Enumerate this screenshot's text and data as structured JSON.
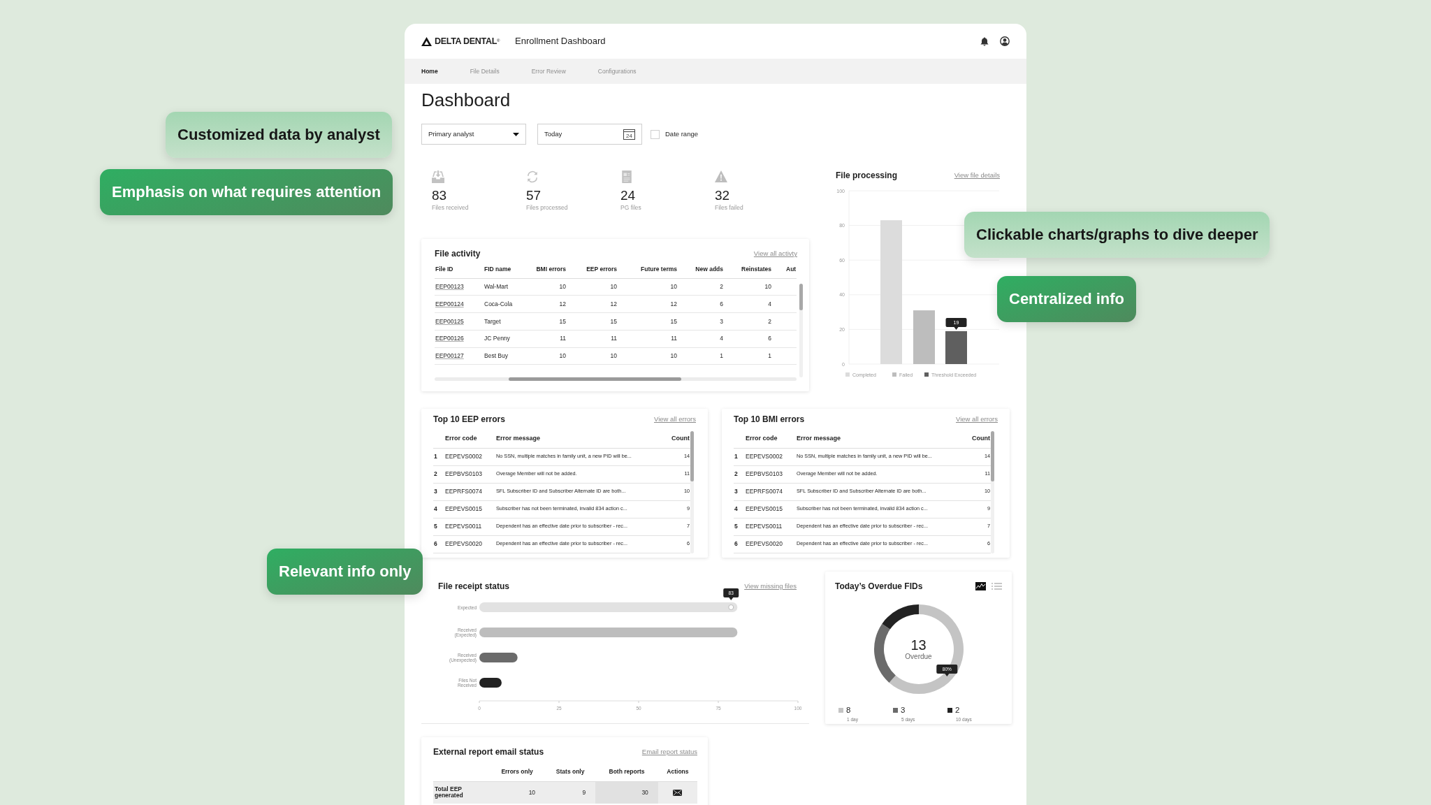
{
  "header": {
    "brand": "DELTA DENTAL$^{®}$",
    "app_title": "Enrollment Dashboard"
  },
  "nav": [
    {
      "label": "Home",
      "selected": true
    },
    {
      "label": "File Details",
      "selected": false
    },
    {
      "label": "Error Review",
      "selected": false
    },
    {
      "label": "Configurations",
      "selected": false
    }
  ],
  "page_title": "Dashboard",
  "filters": {
    "analyst_select": {
      "value": "Primary analyst"
    },
    "date_field": {
      "value": "Today",
      "calendar_day": "24"
    },
    "date_range": {
      "label": "Date range",
      "checked": false
    }
  },
  "stats": [
    {
      "kind": "received",
      "value": "83",
      "label": "Files received"
    },
    {
      "kind": "processed",
      "value": "57",
      "label": "Files processed"
    },
    {
      "kind": "pg",
      "value": "24",
      "label": "PG files"
    },
    {
      "kind": "failed",
      "value": "32",
      "label": "Files failed"
    }
  ],
  "file_processing": {
    "title": "File processing",
    "link": "View file details",
    "chart_data": {
      "type": "bar",
      "ylim": [
        0,
        100
      ],
      "yticks": [
        0,
        20,
        40,
        60,
        80,
        100
      ],
      "series": [
        {
          "name": "Completed",
          "color": "#dcdcdc",
          "values": [
            83
          ]
        },
        {
          "name": "Failed",
          "color": "#bdbdbd",
          "values": [
            31
          ]
        },
        {
          "name": "Threshold Exceeded",
          "color": "#5f5f5f",
          "values": [
            19
          ]
        }
      ],
      "grid": true,
      "legend": true,
      "annotations": [
        {
          "y": 19,
          "text": "19"
        }
      ]
    }
  },
  "file_activity": {
    "title": "File activity",
    "link": "View all activty",
    "columns": [
      "File ID",
      "FID name",
      "BMI errors",
      "EEP errors",
      "Future terms",
      "New adds",
      "Reinstates",
      "Aut"
    ],
    "rows": [
      {
        "cells": [
          "EEP00123",
          "Wal-Mart",
          "10",
          "10",
          "10",
          "2",
          "10"
        ]
      },
      {
        "cells": [
          "EEP00124",
          "Coca-Cola",
          "12",
          "12",
          "12",
          "6",
          "4"
        ]
      },
      {
        "cells": [
          "EEP00125",
          "Target",
          "15",
          "15",
          "15",
          "3",
          "2"
        ]
      },
      {
        "cells": [
          "EEP00126",
          "JC Penny",
          "11",
          "11",
          "11",
          "4",
          "6"
        ]
      },
      {
        "cells": [
          "EEP00127",
          "Best Buy",
          "10",
          "10",
          "10",
          "1",
          "1"
        ]
      }
    ]
  },
  "eep_errors": {
    "title": "Top 10 EEP errors",
    "link": "View all errors",
    "columns": [
      "Error code",
      "Error message",
      "Count"
    ],
    "rows": [
      {
        "rank": "1",
        "code": "EEPEVS0002",
        "message": "No SSN, multiple matches in family unit, a new PID will be...",
        "count": "14"
      },
      {
        "rank": "2",
        "code": "EEPBVS0103",
        "message": "Overage Member will not be added.",
        "count": "11"
      },
      {
        "rank": "3",
        "code": "EEPRFS0074",
        "message": "SFL Subscriber ID and Subscriber Alternate ID are both...",
        "count": "10"
      },
      {
        "rank": "4",
        "code": "EEPEVS0015",
        "message": "Subscriber has not been terminated, invalid 834 action c...",
        "count": "9"
      },
      {
        "rank": "5",
        "code": "EEPEVS0011",
        "message": "Dependent has an effective date prior to subscriber - rec...",
        "count": "7"
      },
      {
        "rank": "6",
        "code": "EEPEVS0020",
        "message": "Dependent has an effective date prior to subscriber - rec...",
        "count": "6"
      }
    ]
  },
  "bmi_errors": {
    "title": "Top 10 BMI errors",
    "link": "View all errors",
    "columns": [
      "Error code",
      "Error message",
      "Count"
    ],
    "rows": [
      {
        "rank": "1",
        "code": "EEPEVS0002",
        "message": "No SSN, multiple matches in family unit, a new PID will be...",
        "count": "14"
      },
      {
        "rank": "2",
        "code": "EEPBVS0103",
        "message": "Overage Member will not be added.",
        "count": "11"
      },
      {
        "rank": "3",
        "code": "EEPRFS0074",
        "message": "SFL Subscriber ID and Subscriber Alternate ID are both...",
        "count": "10"
      },
      {
        "rank": "4",
        "code": "EEPEVS0015",
        "message": "Subscriber has not been terminated, invalid 834 action c...",
        "count": "9"
      },
      {
        "rank": "5",
        "code": "EEPEVS0011",
        "message": "Dependent has an effective date prior to subscriber - rec...",
        "count": "7"
      },
      {
        "rank": "6",
        "code": "EEPEVS0020",
        "message": "Dependent has an effective date prior to subscriber - rec...",
        "count": "6"
      }
    ]
  },
  "file_receipt": {
    "title": "File receipt status",
    "link": "View missing files",
    "chart_data": {
      "type": "bar",
      "orientation": "horizontal",
      "stacked": true,
      "categories": [
        "Expected",
        "Received (Expected)",
        "Received (Unexpected)",
        "Files Not Received"
      ],
      "xlim": [
        0,
        100
      ],
      "xticks": [
        0,
        25,
        50,
        75,
        100
      ],
      "series": [
        {
          "color": "#e2e2e2",
          "values": [
            81,
            null,
            null,
            null
          ]
        },
        {
          "color": "#bdbdbd",
          "values": [
            null,
            81,
            null,
            null
          ]
        },
        {
          "color": "#6b6b6b",
          "values": [
            null,
            null,
            12,
            null
          ]
        },
        {
          "color": "#222222",
          "values": [
            null,
            null,
            null,
            7
          ]
        }
      ],
      "annotations": [
        {
          "x": 79,
          "y": "Expected",
          "text": "83"
        }
      ]
    }
  },
  "overdue": {
    "title": "Today’s Overdue FIDs",
    "views": [
      {
        "kind": "chart",
        "selected": true
      },
      {
        "kind": "list",
        "selected": false
      }
    ],
    "total": "13",
    "total_label": "Overdue",
    "chart_data": {
      "type": "donut",
      "categories": [
        "1 day",
        "5 days",
        "10 days"
      ],
      "values": [
        61.54,
        23.08,
        15.38
      ],
      "annotations": [
        {
          "text": "80%"
        }
      ]
    },
    "legend_values": [
      "8",
      "3",
      "2"
    ]
  },
  "external_report": {
    "title": "External report email status",
    "link": "Email report status",
    "columns": [
      "Errors only",
      "Stats only",
      "Both reports",
      "Actions"
    ],
    "rows": [
      {
        "label": "Total EEP generated",
        "cells": [
          "10",
          "9",
          "30"
        ],
        "action": {
          "kind": "email"
        }
      }
    ]
  },
  "callouts": [
    {
      "kind": "light",
      "text": "Customized data by analyst"
    },
    {
      "kind": "dark",
      "text": "Emphasis on what requires attention"
    },
    {
      "kind": "light",
      "text": "Clickable charts/graphs to dive deeper"
    },
    {
      "kind": "dark",
      "text": "Centralized info"
    },
    {
      "kind": "dark",
      "text": "Relevant info only"
    }
  ]
}
